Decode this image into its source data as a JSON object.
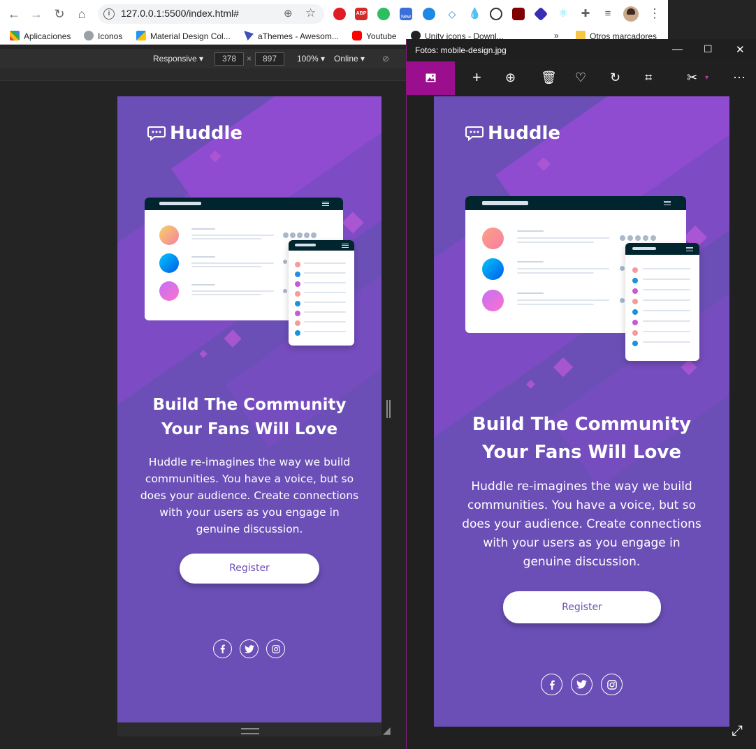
{
  "browser": {
    "url": "127.0.0.1:5500/index.html#",
    "bookmarks": [
      "Aplicaciones",
      "Iconos",
      "Material Design Col...",
      "aThemes - Awesom...",
      "Youtube",
      "Unity icons - Downl...",
      "»",
      "Otros marcadores"
    ],
    "extensions": [
      {
        "name": "opera-icon",
        "color": "#e01d24"
      },
      {
        "name": "adblock-icon",
        "color": "#d32a2a",
        "label": "ABP"
      },
      {
        "name": "evernote-icon",
        "color": "#2dbe60"
      },
      {
        "name": "news-icon",
        "color": "#3b6fd8",
        "label": "New"
      },
      {
        "name": "messenger-icon",
        "color": "#1e88e5"
      },
      {
        "name": "code-icon",
        "color": "#1e88e5"
      },
      {
        "name": "drop-icon",
        "color": "#26a6e0"
      },
      {
        "name": "sync-icon",
        "color": "#333333"
      },
      {
        "name": "ublock-icon",
        "color": "#800000"
      },
      {
        "name": "stack-icon",
        "color": "#3a2db5"
      },
      {
        "name": "react-icon",
        "color": "#61dafb"
      },
      {
        "name": "puzzle-icon",
        "color": "#5f6368"
      },
      {
        "name": "playlist-icon",
        "color": "#5f6368"
      }
    ]
  },
  "devtools": {
    "mode": "Responsive",
    "width": "378",
    "height": "897",
    "zoom": "100%",
    "network": "Online"
  },
  "huddle": {
    "brand": "Huddle",
    "headline_line1": "Build The Community",
    "headline_line2": "Your Fans Will Love",
    "body": "Huddle re-imagines the way we build communities. You have a voice, but so does your audience. Create connections with your users as you engage in genuine discussion.",
    "cta": "Register",
    "socials": [
      "facebook-icon",
      "twitter-icon",
      "instagram-icon"
    ],
    "colors": {
      "background": "#6b4fb7",
      "accent": "#8f4cd0",
      "button_text": "#6b4fb7"
    }
  },
  "photos": {
    "title": "Fotos: mobile-design.jpg"
  }
}
